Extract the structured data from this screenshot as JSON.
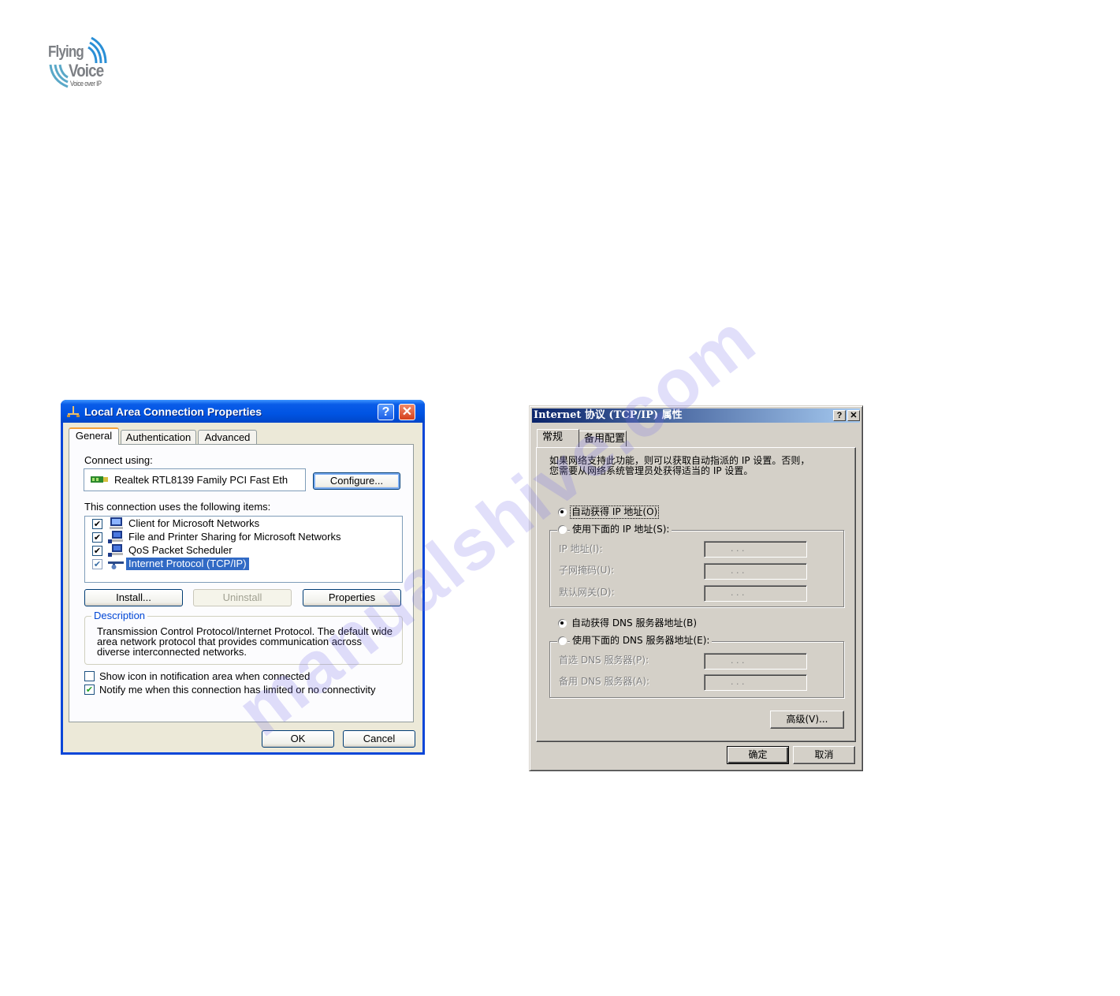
{
  "logo": {
    "line1": "Flying",
    "line2": "Voice",
    "tagline": "Voice over IP",
    "colors": {
      "text": "#7c7f84",
      "waves": "#2a8fd6"
    }
  },
  "watermark": "manualshive.com",
  "xp_dialog": {
    "title": "Local Area Connection Properties",
    "title_icon": "network-connection-icon",
    "help_button": "?",
    "close_button": "✕",
    "tabs": [
      {
        "label": "General",
        "active": true
      },
      {
        "label": "Authentication",
        "active": false
      },
      {
        "label": "Advanced",
        "active": false
      }
    ],
    "connect_using_label": "Connect using:",
    "adapter_name": "Realtek RTL8139 Family PCI Fast Eth",
    "configure_button": "Configure...",
    "items_label": "This connection uses the following items:",
    "items": [
      {
        "label": "Client for Microsoft Networks",
        "checked": true,
        "selected": false,
        "icon": "network-client-icon"
      },
      {
        "label": "File and Printer Sharing for Microsoft Networks",
        "checked": true,
        "selected": false,
        "icon": "network-service-icon"
      },
      {
        "label": "QoS Packet Scheduler",
        "checked": true,
        "selected": false,
        "icon": "network-service-icon"
      },
      {
        "label": "Internet Protocol (TCP/IP)",
        "checked": true,
        "selected": true,
        "icon": "network-protocol-icon"
      }
    ],
    "install_button": "Install...",
    "uninstall_button": "Uninstall",
    "properties_button": "Properties",
    "description_legend": "Description",
    "description_text": "Transmission Control Protocol/Internet Protocol. The default wide area network protocol that provides communication across diverse interconnected networks.",
    "show_icon_label": "Show icon in notification area when connected",
    "show_icon_checked": false,
    "notify_label": "Notify me when this connection has limited or no connectivity",
    "notify_checked": true,
    "ok_button": "OK",
    "cancel_button": "Cancel",
    "colors": {
      "titlebar": "#0054e3",
      "face": "#ece9d8",
      "selection": "#316ac5",
      "legend": "#0046d5"
    }
  },
  "cn_dialog": {
    "title": "Internet 协议 (TCP/IP) 属性",
    "help_button": "?",
    "close_button": "✕",
    "tabs": [
      {
        "label": "常规",
        "active": true
      },
      {
        "label": "备用配置",
        "active": false
      }
    ],
    "intro_line1": "如果网络支持此功能，则可以获取自动指派的 IP 设置。否则，",
    "intro_line2": "您需要从网络系统管理员处获得适当的 IP 设置。",
    "auto_ip_label": "自动获得 IP 地址(O)",
    "auto_ip_selected": true,
    "manual_ip_label": "使用下面的 IP 地址(S):",
    "manual_ip_selected": false,
    "ip_address_label": "IP 地址(I):",
    "subnet_mask_label": "子网掩码(U):",
    "gateway_label": "默认网关(D):",
    "ip_address_value": ". . .",
    "subnet_mask_value": ". . .",
    "gateway_value": ". . .",
    "auto_dns_label": "自动获得 DNS 服务器地址(B)",
    "auto_dns_selected": true,
    "manual_dns_label": "使用下面的 DNS 服务器地址(E):",
    "manual_dns_selected": false,
    "preferred_dns_label": "首选 DNS 服务器(P):",
    "alternate_dns_label": "备用 DNS 服务器(A):",
    "preferred_dns_value": ". . .",
    "alternate_dns_value": ". . .",
    "advanced_button": "高级(V)...",
    "ok_button": "确定",
    "cancel_button": "取消",
    "colors": {
      "titlebar_start": "#0a246a",
      "titlebar_end": "#a6caf0",
      "face": "#d4d0c8"
    }
  }
}
